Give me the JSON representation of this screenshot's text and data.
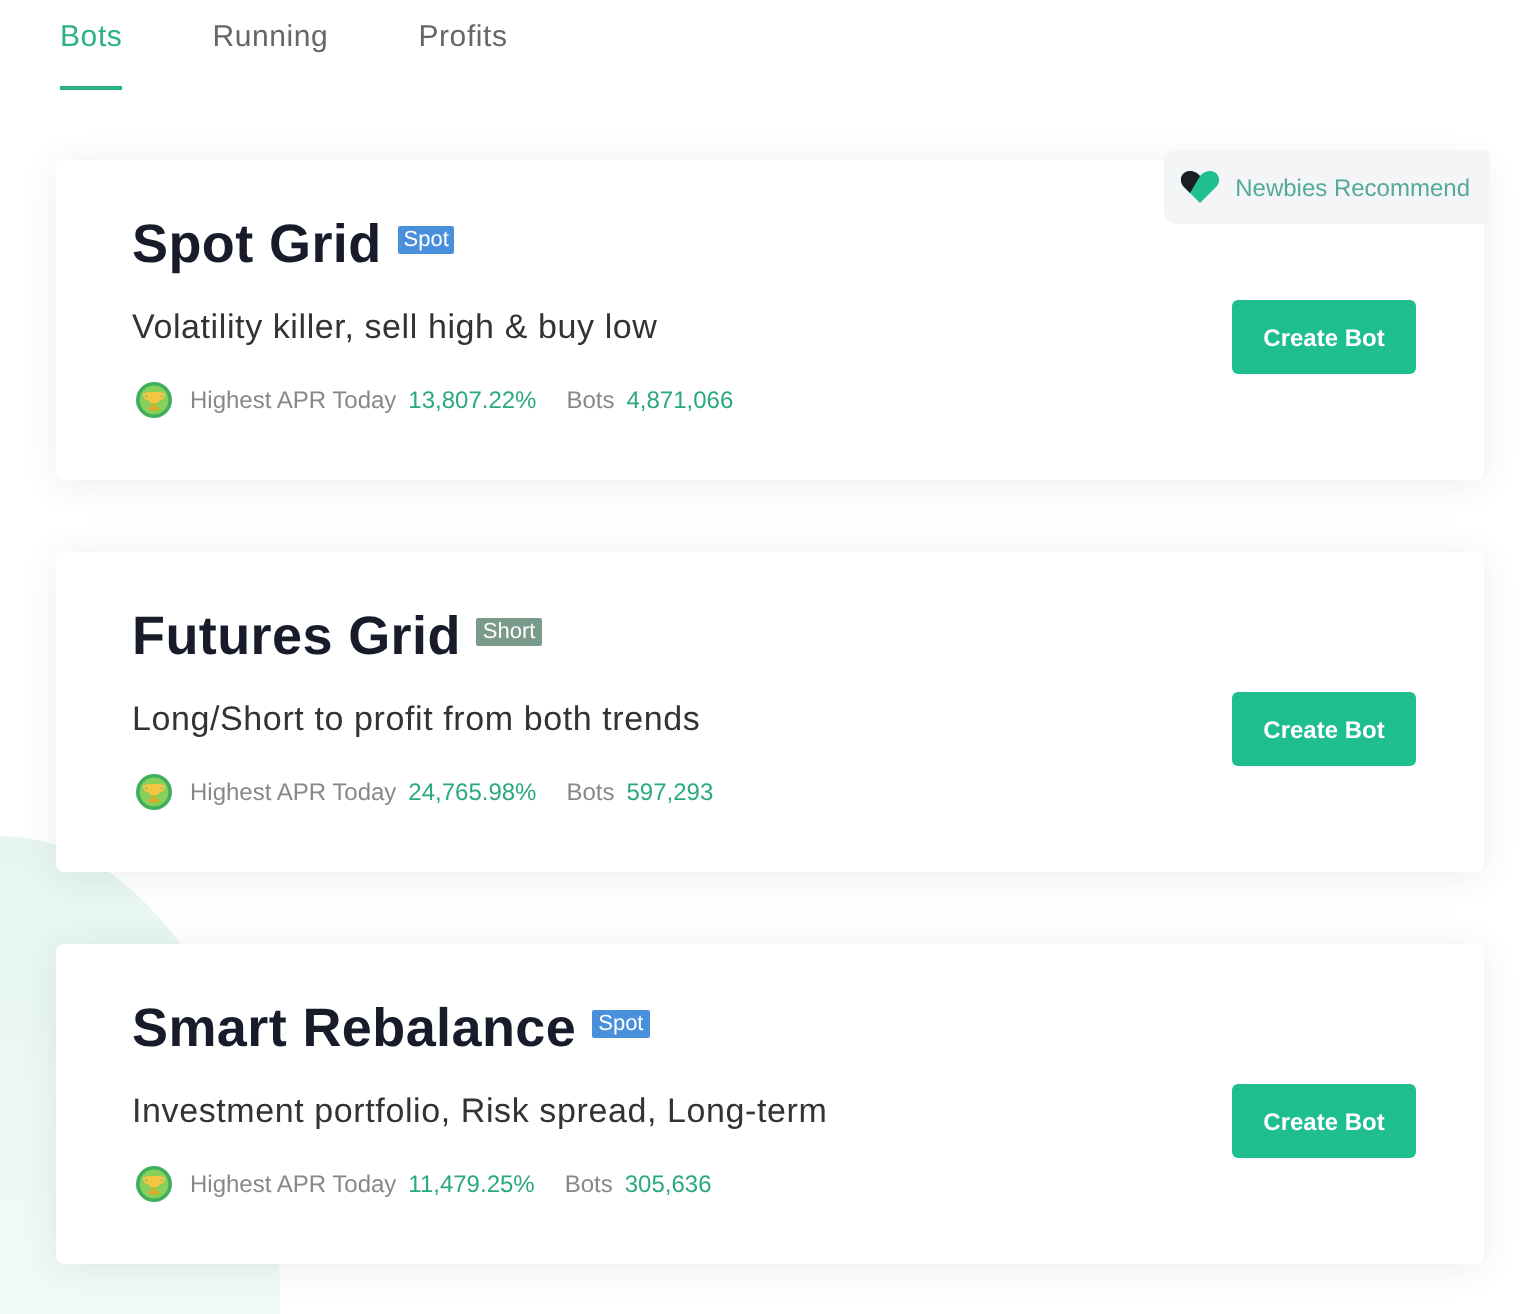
{
  "tabs": [
    {
      "label": "Bots",
      "selected": true
    },
    {
      "label": "Running",
      "selected": false
    },
    {
      "label": "Profits",
      "selected": false
    }
  ],
  "bots": [
    {
      "title": "Spot Grid",
      "tag": {
        "label": "Spot",
        "color": "#4a8fdb"
      },
      "badge": "Newbies Recommend",
      "description": "Volatility killer, sell high & buy low",
      "apr_label": "Highest APR Today",
      "apr": "13,807.22%",
      "bots_label": "Bots",
      "bots_count": "4,871,066",
      "button": "Create Bot"
    },
    {
      "title": "Futures Grid",
      "tag": {
        "label": "Short",
        "color": "#7a9a8c"
      },
      "description": "Long/Short to profit from both trends",
      "apr_label": "Highest APR Today",
      "apr": "24,765.98%",
      "bots_label": "Bots",
      "bots_count": "597,293",
      "button": "Create Bot"
    },
    {
      "title": "Smart Rebalance",
      "tag": {
        "label": "Spot",
        "color": "#4a8fdb"
      },
      "description": "Investment portfolio, Risk spread, Long-term",
      "apr_label": "Highest APR Today",
      "apr": "11,479.25%",
      "bots_label": "Bots",
      "bots_count": "305,636",
      "button": "Create Bot"
    }
  ]
}
